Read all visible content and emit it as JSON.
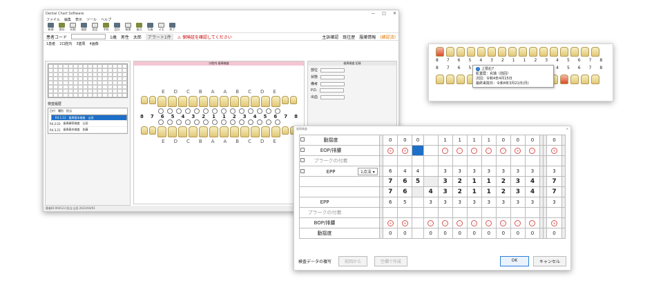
{
  "main": {
    "window_title": "Dental Chart Software",
    "menu": [
      "ファイル",
      "編集",
      "表示",
      "ツール",
      "ヘルプ"
    ],
    "toolbar_items": [
      "新規",
      "保存",
      "印刷",
      "検索",
      "設定",
      "予約",
      "会計",
      "帳票",
      "歯式",
      "写真",
      "メモ",
      "終了"
    ],
    "patient": {
      "label": "患者コード",
      "age": "1歳",
      "sex": "男性",
      "name": "太郎",
      "alert_label": "アラート1件",
      "alert_text": "⚠ 保険証を確認してください",
      "right_items": [
        "主訴確認",
        "既往歴",
        "服薬情報"
      ],
      "orange_item": "(確認済)"
    },
    "tabs": [
      "1患者",
      "2口腔内",
      "3歯周",
      "4画像"
    ],
    "center_header": "口腔内 歯周検査",
    "right_header": "歯周検査 記録",
    "right_fields": [
      "部位",
      "状態",
      "備考",
      "P.D.",
      "出血"
    ],
    "history_title": "検査履歴",
    "history_cols": [
      "日付",
      "種別",
      "担当"
    ],
    "history_rows": [
      {
        "date": "R4.1.12",
        "type": "歯周基本検査",
        "by": "山田"
      },
      {
        "date": "R4.2.03",
        "type": "歯周精密検査",
        "by": "山田"
      },
      {
        "date": "R4.3.21",
        "type": "歯周基本検査",
        "by": "佐藤"
      }
    ],
    "upper_letters": [
      "E",
      "D",
      "C",
      "B",
      "A",
      "A",
      "B",
      "C",
      "D",
      "E"
    ],
    "numbers": [
      "8",
      "7",
      "6",
      "5",
      "4",
      "3",
      "2",
      "1",
      "1",
      "2",
      "3",
      "4",
      "5",
      "6",
      "7",
      "8"
    ],
    "lower_letters": [
      "E",
      "D",
      "C",
      "B",
      "A",
      "A",
      "B",
      "C",
      "D",
      "E"
    ],
    "status": "患者ID:000123  担当:山田  2022/04/01"
  },
  "popup": {
    "upper_nums": [
      "8",
      "7",
      "6",
      "5",
      "4",
      "3",
      "2",
      "1",
      "1",
      "2",
      "3",
      "4",
      "5",
      "6",
      "7",
      "8"
    ],
    "lower_nums": [
      "8",
      "7",
      "6",
      "5",
      "4",
      "3",
      "2",
      "1",
      "1",
      "2",
      "3",
      "4",
      "5",
      "6",
      "7",
      "8"
    ],
    "tip_title": "上顎右7",
    "tip_lines": [
      "処置歴：充填（前回）",
      "次回：令和4年4月15日",
      "最終来院日：令和4年3月21日(月)"
    ]
  },
  "dialog": {
    "title": "歯周検査",
    "rows": [
      {
        "label": "動揺度",
        "vals": [
          "",
          "0",
          "0",
          "0",
          "",
          "1",
          "1",
          "1",
          "1",
          "0",
          "0",
          "0",
          "",
          "",
          "0",
          ""
        ]
      },
      {
        "label": "EOP/排膿",
        "vals": [
          "",
          "(+)",
          "(+)",
          "(+)",
          "",
          "(-)",
          "(-)",
          "(-)",
          "(-)",
          "(-)",
          "(+)",
          "(-)",
          "",
          "",
          "(+)",
          ""
        ]
      },
      {
        "label": "プラークの付着",
        "vals": [
          "",
          "",
          "",
          "",
          "",
          "",
          "",
          "",
          "",
          "",
          "",
          "",
          "",
          "",
          "",
          ""
        ]
      },
      {
        "label": "EPP",
        "select": "1点法",
        "vals": [
          "",
          "6",
          "4",
          "4",
          "",
          "3",
          "3",
          "3",
          "3",
          "3",
          "3",
          "3",
          "",
          "",
          "3",
          ""
        ]
      }
    ],
    "tooth_upper": [
      "",
      "7",
      "6",
      "5",
      "",
      "3",
      "2",
      "1",
      "1",
      "2",
      "3",
      "4",
      "",
      "",
      "7",
      ""
    ],
    "tooth_lower": [
      "",
      "7",
      "6",
      "",
      "4",
      "3",
      "2",
      "1",
      "1",
      "2",
      "3",
      "4",
      "",
      "",
      "7",
      ""
    ],
    "rows_lower": [
      {
        "label": "EPP",
        "vals": [
          "",
          "6",
          "5",
          "",
          "3",
          "3",
          "3",
          "3",
          "3",
          "3",
          "3",
          "3",
          "",
          "",
          "3",
          ""
        ]
      },
      {
        "label": "プラークの付着",
        "vals": [
          "",
          "",
          "",
          "",
          "",
          "",
          "",
          "",
          "",
          "",
          "",
          "",
          "",
          "",
          "",
          ""
        ]
      },
      {
        "label": "BOP/排膿",
        "vals": [
          "",
          "(+)",
          "(+)",
          "",
          "(-)",
          "(-)",
          "(-)",
          "(-)",
          "(-)",
          "(-)",
          "(-)",
          "(-)",
          "",
          "",
          "(+)",
          ""
        ]
      },
      {
        "label": "動揺度",
        "vals": [
          "",
          "0",
          "0",
          "",
          "0",
          "0",
          "0",
          "0",
          "0",
          "0",
          "0",
          "0",
          "",
          "",
          "0",
          ""
        ]
      }
    ],
    "footer_label": "検査データの複写",
    "btn1": "前回から",
    "btn2": "空欄で作成",
    "ok": "OK",
    "cancel": "キャンセル"
  }
}
